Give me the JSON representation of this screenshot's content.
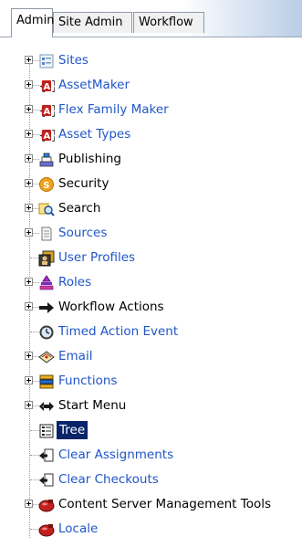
{
  "tabs": [
    {
      "label": "Admin",
      "active": true
    },
    {
      "label": "Site Admin",
      "active": false
    },
    {
      "label": "Workflow",
      "active": false
    }
  ],
  "tree_items": [
    {
      "label": "Sites",
      "icon": "sites-icon",
      "expandable": true,
      "style": "link"
    },
    {
      "label": "AssetMaker",
      "icon": "asset-maker-icon",
      "expandable": true,
      "style": "link"
    },
    {
      "label": "Flex Family Maker",
      "icon": "flex-family-icon",
      "expandable": true,
      "style": "link"
    },
    {
      "label": "Asset Types",
      "icon": "asset-types-icon",
      "expandable": true,
      "style": "link"
    },
    {
      "label": "Publishing",
      "icon": "publishing-icon",
      "expandable": true,
      "style": "dark"
    },
    {
      "label": "Security",
      "icon": "security-icon",
      "expandable": true,
      "style": "dark"
    },
    {
      "label": "Search",
      "icon": "search-icon",
      "expandable": true,
      "style": "dark"
    },
    {
      "label": "Sources",
      "icon": "sources-icon",
      "expandable": true,
      "style": "link"
    },
    {
      "label": "User Profiles",
      "icon": "user-profiles-icon",
      "expandable": false,
      "style": "link"
    },
    {
      "label": "Roles",
      "icon": "roles-icon",
      "expandable": true,
      "style": "link"
    },
    {
      "label": "Workflow Actions",
      "icon": "arrow-right-icon",
      "expandable": true,
      "style": "dark"
    },
    {
      "label": "Timed Action Event",
      "icon": "clock-icon",
      "expandable": false,
      "style": "link"
    },
    {
      "label": "Email",
      "icon": "email-icon",
      "expandable": true,
      "style": "link"
    },
    {
      "label": "Functions",
      "icon": "functions-icon",
      "expandable": true,
      "style": "link"
    },
    {
      "label": "Start Menu",
      "icon": "start-menu-icon",
      "expandable": true,
      "style": "dark"
    },
    {
      "label": "Tree",
      "icon": "tree-icon",
      "expandable": false,
      "style": "selected"
    },
    {
      "label": "Clear Assignments",
      "icon": "clear-assignments-icon",
      "expandable": false,
      "style": "link"
    },
    {
      "label": "Clear Checkouts",
      "icon": "clear-checkouts-icon",
      "expandable": false,
      "style": "link"
    },
    {
      "label": "Content Server Management Tools",
      "icon": "management-tools-icon",
      "expandable": true,
      "style": "dark"
    },
    {
      "label": "Locale",
      "icon": "locale-icon",
      "expandable": false,
      "style": "link"
    }
  ],
  "colors": {
    "link": "#1f55c9",
    "selected_bg": "#0a246a",
    "asset_red": "#c0201e"
  }
}
